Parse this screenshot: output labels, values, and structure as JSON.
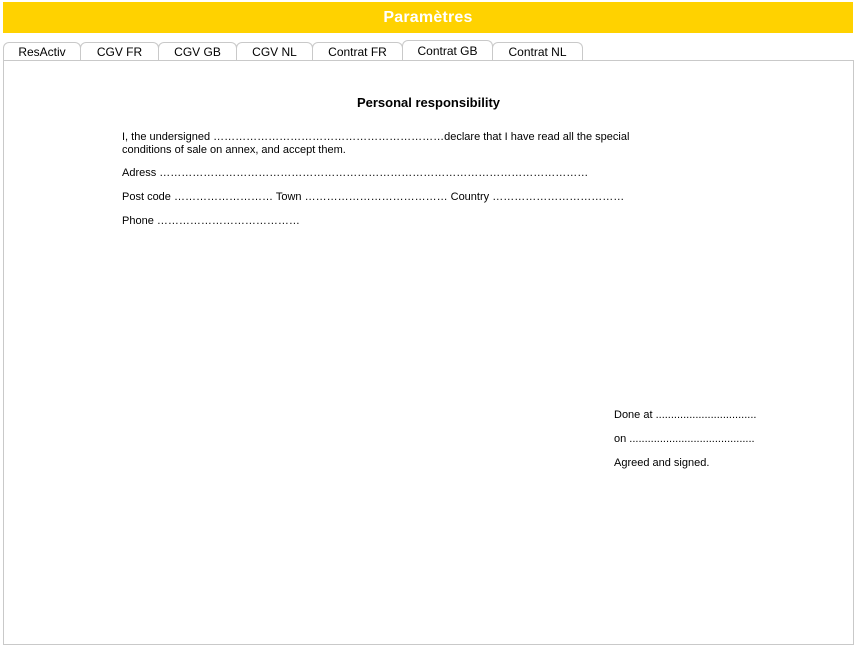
{
  "window": {
    "title": "Paramètres"
  },
  "tabs": [
    {
      "label": "ResActiv",
      "active": false
    },
    {
      "label": "CGV FR",
      "active": false
    },
    {
      "label": "CGV GB",
      "active": false
    },
    {
      "label": "CGV NL",
      "active": false
    },
    {
      "label": "Contrat FR",
      "active": false
    },
    {
      "label": "Contrat GB",
      "active": true
    },
    {
      "label": "Contrat NL",
      "active": false
    }
  ],
  "document": {
    "title": "Personal responsibility",
    "declaration_line1": "I, the undersigned ………………………………………………………declare that I have read all the special",
    "declaration_line2": "conditions of sale on annex, and accept them.",
    "address_line": "Adress  ………………………………………………………………………………………………………",
    "postcode_line": "Post code ……………………… Town ………………………………… Country ………………………………",
    "phone_line": "Phone …………………………………",
    "done_at": "Done at .................................",
    "on": "on .........................................",
    "agreed": "Agreed and signed."
  },
  "colors": {
    "title_bar": "#ffd200",
    "title_text": "#ffffff",
    "border": "#c9c9c9"
  }
}
